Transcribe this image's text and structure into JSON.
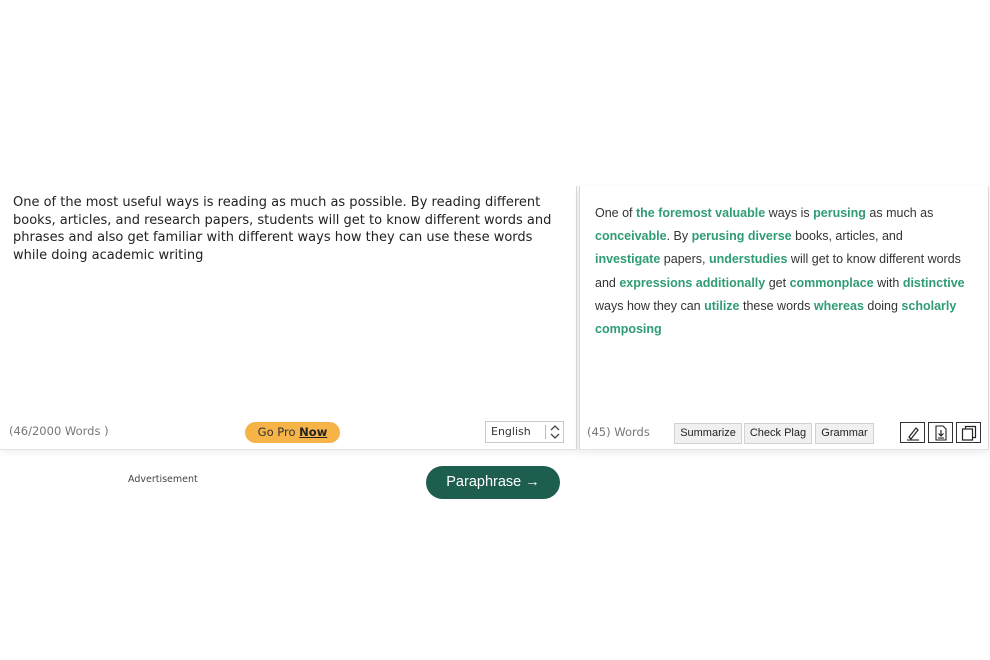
{
  "input": {
    "text": "One of the most useful ways is reading as much as possible. By reading different books, articles, and research papers, students will get to know different words and phrases and also get familiar with different ways how they can use these words while doing academic writing",
    "word_count": "(46/2000 Words )",
    "go_pro_label": "Go Pro",
    "go_pro_now": "Now",
    "language": "English"
  },
  "output": {
    "segments": [
      {
        "t": "One of ",
        "h": false
      },
      {
        "t": "the foremost valuable",
        "h": true
      },
      {
        "t": " ways is ",
        "h": false
      },
      {
        "t": "perusing",
        "h": true
      },
      {
        "t": " as much as ",
        "h": false
      },
      {
        "t": "conceivable",
        "h": true
      },
      {
        "t": ". By ",
        "h": false
      },
      {
        "t": "perusing diverse",
        "h": true
      },
      {
        "t": " books, articles, and ",
        "h": false
      },
      {
        "t": "investigate",
        "h": true
      },
      {
        "t": " papers, ",
        "h": false
      },
      {
        "t": "understudies",
        "h": true
      },
      {
        "t": " will get to know different words and ",
        "h": false
      },
      {
        "t": "expressions additionally",
        "h": true
      },
      {
        "t": " get ",
        "h": false
      },
      {
        "t": "commonplace",
        "h": true
      },
      {
        "t": " with ",
        "h": false
      },
      {
        "t": "distinctive",
        "h": true
      },
      {
        "t": " ways how they can ",
        "h": false
      },
      {
        "t": "utilize",
        "h": true
      },
      {
        "t": " these words ",
        "h": false
      },
      {
        "t": "whereas",
        "h": true
      },
      {
        "t": " doing ",
        "h": false
      },
      {
        "t": "scholarly composing",
        "h": true
      }
    ],
    "word_count": "(45) Words",
    "buttons": {
      "summarize": "Summarize",
      "check_plag": "Check Plag",
      "grammar": "Grammar"
    }
  },
  "advertisement_label": "Advertisement",
  "paraphrase_button": "Paraphrase →",
  "colors": {
    "highlight": "#2f9c74",
    "paraphrase_bg": "#1d5e4e",
    "go_pro_bg": "#f6b348"
  },
  "icons": [
    "eraser-icon",
    "download-icon",
    "copy-icon",
    "stepper-icon"
  ]
}
